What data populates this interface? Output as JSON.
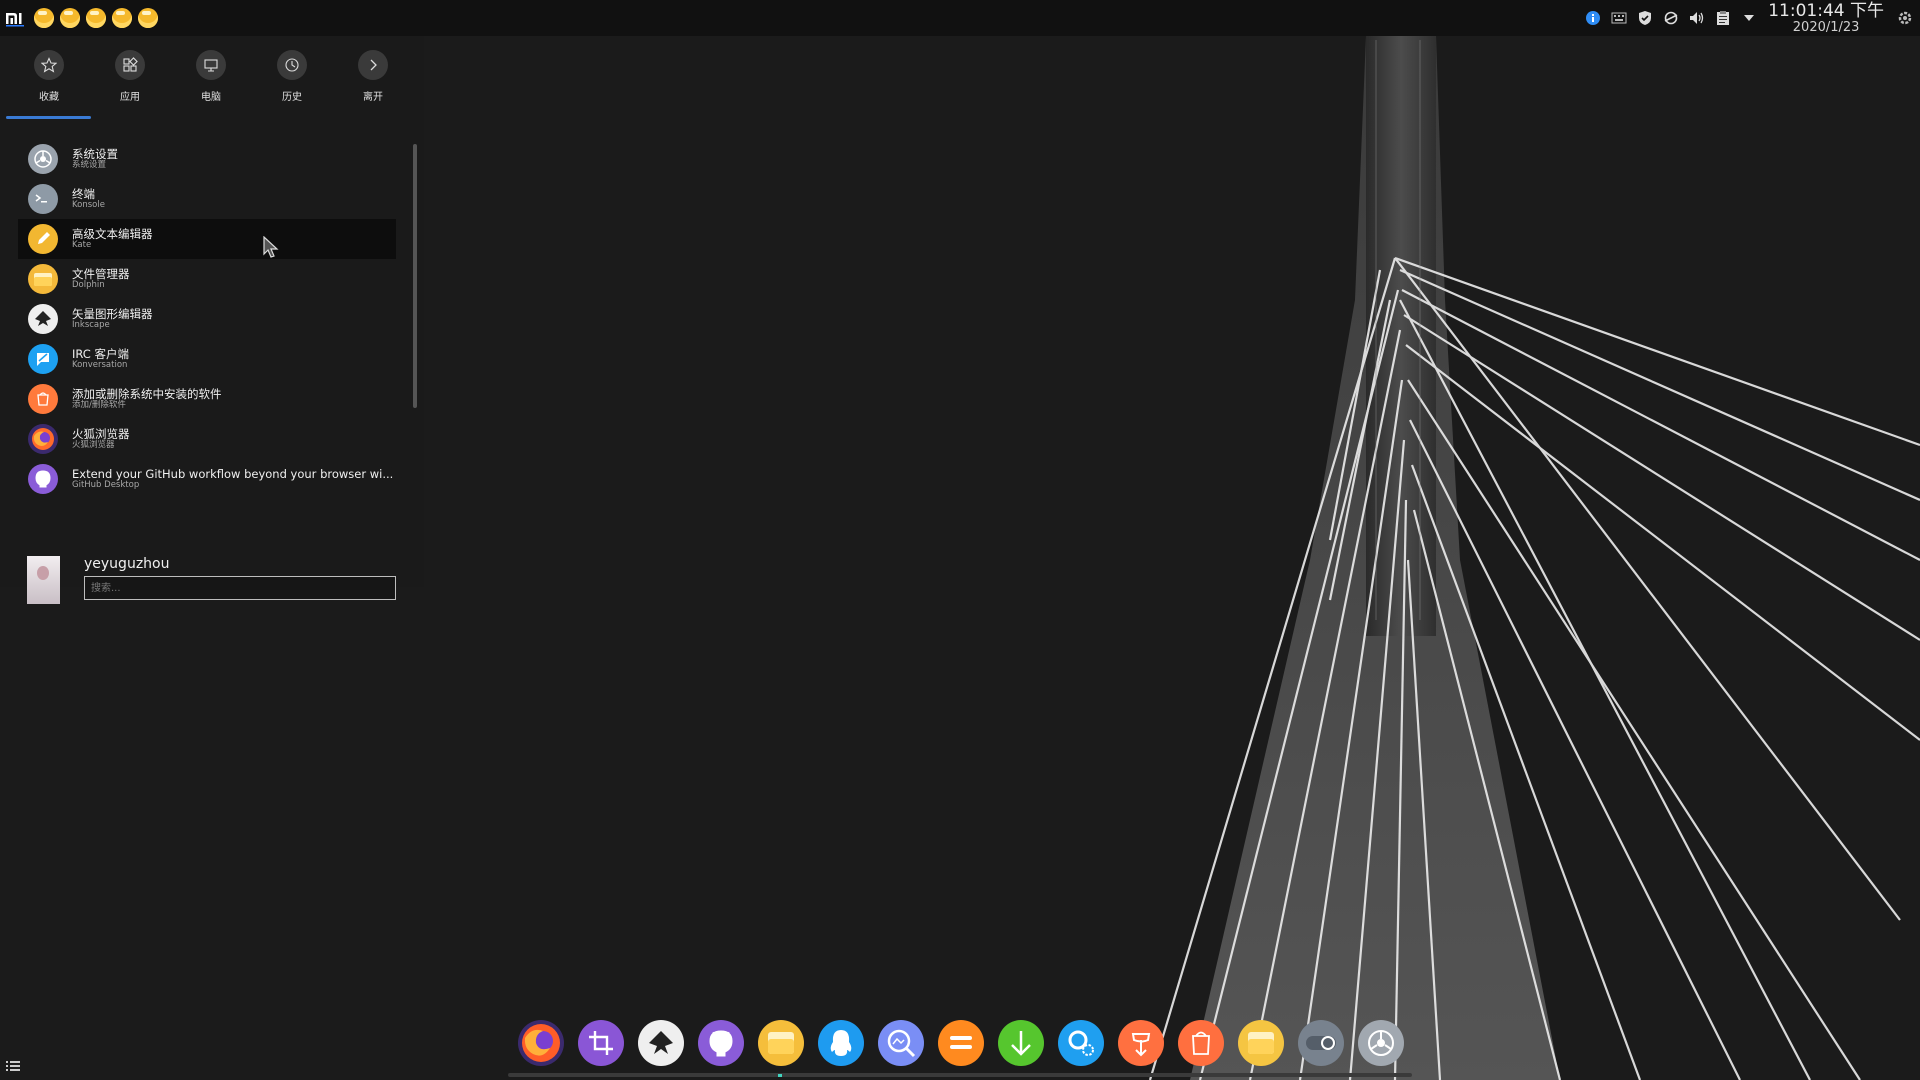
{
  "top_panel": {
    "clock_time": "11:01:44 下午",
    "clock_date": "2020/1/23",
    "tray_icons": [
      "info-icon",
      "keyboard-icon",
      "shield-icon",
      "sync-icon",
      "volume-icon",
      "clipboard-icon",
      "expand-arrow-icon",
      "settings-gear-icon"
    ],
    "pinned_icons": [
      "file-manager-icon",
      "file-manager-icon",
      "file-manager-icon",
      "file-manager-icon",
      "file-manager-icon"
    ]
  },
  "launcher": {
    "tabs": [
      {
        "label": "收藏",
        "icon": "star-icon"
      },
      {
        "label": "应用",
        "icon": "apps-grid-icon"
      },
      {
        "label": "电脑",
        "icon": "monitor-icon"
      },
      {
        "label": "历史",
        "icon": "clock-icon"
      },
      {
        "label": "离开",
        "icon": "chevron-right-icon"
      }
    ],
    "apps": [
      {
        "title": "系统设置",
        "subtitle": "系统设置",
        "icon": "system-settings-icon",
        "color": "#9aa3ad"
      },
      {
        "title": "终端",
        "subtitle": "Konsole",
        "icon": "terminal-icon",
        "color": "#8e9aa6"
      },
      {
        "title": "高级文本编辑器",
        "subtitle": "Kate",
        "icon": "kate-pen-icon",
        "color": "#f2b731"
      },
      {
        "title": "文件管理器",
        "subtitle": "Dolphin",
        "icon": "folder-icon",
        "color": "#f4b93a"
      },
      {
        "title": "矢量图形编辑器",
        "subtitle": "Inkscape",
        "icon": "inkscape-icon",
        "color": "#eeeeee"
      },
      {
        "title": "IRC 客户端",
        "subtitle": "Konversation",
        "icon": "chat-bubble-icon",
        "color": "#1da1f2"
      },
      {
        "title": "添加或删除系统中安装的软件",
        "subtitle": "添加/删除软件",
        "icon": "shop-bag-icon",
        "color": "#ff7a3c"
      },
      {
        "title": "火狐浏览器",
        "subtitle": "火狐浏览器",
        "icon": "firefox-icon",
        "color": "#ff6a2c"
      },
      {
        "title": "Extend your GitHub workflow beyond your browser wi...",
        "subtitle": "GitHub Desktop",
        "icon": "github-icon",
        "color": "#8a5cd8"
      }
    ],
    "user": {
      "name": "yeyuguzhou"
    },
    "search": {
      "placeholder": "搜索..."
    }
  },
  "dock": {
    "items": [
      {
        "name": "firefox-icon",
        "color": "#ff5d28"
      },
      {
        "name": "screenshot-crop-icon",
        "color": "#8a56d6"
      },
      {
        "name": "inkscape-icon",
        "color": "#efefef"
      },
      {
        "name": "github-icon",
        "color": "#8a5cd8"
      },
      {
        "name": "file-manager-icon",
        "color": "#f5be3b"
      },
      {
        "name": "qq-penguin-icon",
        "color": "#1e9bf0"
      },
      {
        "name": "image-viewer-icon",
        "color": "#7a8ef5"
      },
      {
        "name": "calculator-icon",
        "color": "#ff8a1f"
      },
      {
        "name": "download-arrow-icon",
        "color": "#56c62e"
      },
      {
        "name": "config-gear-icon",
        "color": "#1f9ff0"
      },
      {
        "name": "package-installer-icon",
        "color": "#ff7040"
      },
      {
        "name": "shop-bag-icon",
        "color": "#ff6f3f"
      },
      {
        "name": "folder-icon",
        "color": "#f5c542"
      },
      {
        "name": "toggle-switch-icon",
        "color": "#78828e"
      },
      {
        "name": "system-settings-icon",
        "color": "#a1a8b0"
      }
    ]
  }
}
